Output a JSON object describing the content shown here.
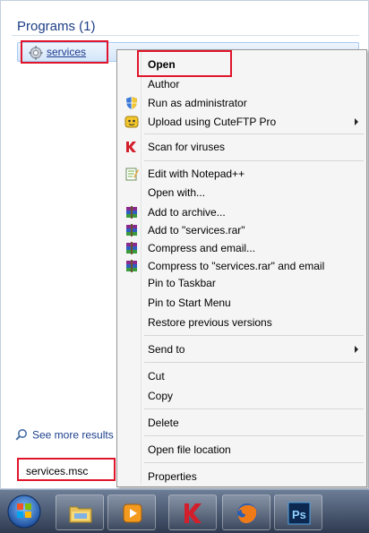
{
  "start_menu": {
    "section_header": "Programs (1)",
    "result": {
      "label": "services",
      "icon": "gear-icon"
    },
    "see_more": {
      "label": "See more results",
      "icon": "magnifier-icon"
    },
    "search": {
      "value": "services.msc"
    }
  },
  "context_menu": {
    "items": [
      {
        "label": "Open",
        "bold": true,
        "icon": null,
        "submenu": false
      },
      {
        "label": "Author",
        "bold": false,
        "icon": null,
        "submenu": false
      },
      {
        "label": "Run as administrator",
        "bold": false,
        "icon": "shield-icon",
        "submenu": false
      },
      {
        "label": "Upload using CuteFTP Pro",
        "bold": false,
        "icon": "cuteftp-icon",
        "submenu": true
      },
      {
        "label": "Scan for viruses",
        "bold": false,
        "icon": "kaspersky-icon",
        "submenu": false
      },
      {
        "label": "Edit with Notepad++",
        "bold": false,
        "icon": "notepad-icon",
        "submenu": false
      },
      {
        "label": "Open with...",
        "bold": false,
        "icon": null,
        "submenu": false
      },
      {
        "label": "Add to archive...",
        "bold": false,
        "icon": "winrar-icon",
        "submenu": false
      },
      {
        "label": "Add to \"services.rar\"",
        "bold": false,
        "icon": "winrar-icon",
        "submenu": false
      },
      {
        "label": "Compress and email...",
        "bold": false,
        "icon": "winrar-icon",
        "submenu": false
      },
      {
        "label": "Compress to \"services.rar\" and email",
        "bold": false,
        "icon": "winrar-icon",
        "submenu": false
      },
      {
        "label": "Pin to Taskbar",
        "bold": false,
        "icon": null,
        "submenu": false
      },
      {
        "label": "Pin to Start Menu",
        "bold": false,
        "icon": null,
        "submenu": false
      },
      {
        "label": "Restore previous versions",
        "bold": false,
        "icon": null,
        "submenu": false
      },
      {
        "label": "Send to",
        "bold": false,
        "icon": null,
        "submenu": true
      },
      {
        "label": "Cut",
        "bold": false,
        "icon": null,
        "submenu": false
      },
      {
        "label": "Copy",
        "bold": false,
        "icon": null,
        "submenu": false
      },
      {
        "label": "Delete",
        "bold": false,
        "icon": null,
        "submenu": false
      },
      {
        "label": "Open file location",
        "bold": false,
        "icon": null,
        "submenu": false
      },
      {
        "label": "Properties",
        "bold": false,
        "icon": null,
        "submenu": false
      }
    ]
  },
  "taskbar": {
    "start_icon": "windows-orb-icon",
    "buttons": [
      {
        "icon": "explorer-folder-icon"
      },
      {
        "icon": "media-player-icon"
      },
      {
        "icon": "kaspersky-icon"
      },
      {
        "icon": "firefox-icon"
      },
      {
        "icon": "photoshop-icon",
        "text": "Ps"
      }
    ]
  },
  "colors": {
    "highlight_box": "#e0152b",
    "header_text": "#1e3e87",
    "menu_bg": "#f5f5f5"
  }
}
